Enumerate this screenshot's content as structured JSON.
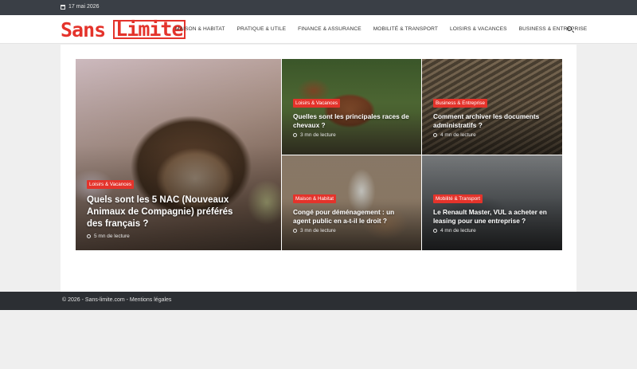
{
  "topbar": {
    "date": "17 mai 2026",
    "date_icon": "calendar-icon"
  },
  "header": {
    "logo": {
      "part1": "Sans",
      "part2": "Limite"
    },
    "nav": [
      "MAISON & HABITAT",
      "PRATIQUE & UTILE",
      "FINANCE & ASSURANCE",
      "MOBILITÉ & TRANSPORT",
      "LOISIRS & VACANCES",
      "BUSINESS & ENTREPRISE"
    ],
    "search_icon": "search-icon"
  },
  "articles": [
    {
      "category": "Loisirs & Vacances",
      "title": "Quels sont les 5 NAC (Nouveaux Animaux de Compagnie) préférés des français ?",
      "read_time": "5 mn de lecture"
    },
    {
      "category": "Loisirs & Vacances",
      "title": "Quelles sont les principales races de chevaux ?",
      "read_time": "3 mn de lecture"
    },
    {
      "category": "Business & Entreprise",
      "title": "Comment archiver les documents administratifs ?",
      "read_time": "4 mn de lecture"
    },
    {
      "category": "Maison & Habitat",
      "title": "Congé pour déménagement : un agent public en a-t-il le droit ?",
      "read_time": "3 mn de lecture"
    },
    {
      "category": "Mobilité & Transport",
      "title": "Le Renault Master, VUL a acheter en leasing pour une entreprise ?",
      "read_time": "4 mn de lecture"
    }
  ],
  "footer": {
    "text": "© 2026 - Sans-limite.com - Mentions légales"
  },
  "colors": {
    "accent": "#e4332b",
    "topbar": "#3a3f46",
    "footer": "#2c2f33"
  }
}
